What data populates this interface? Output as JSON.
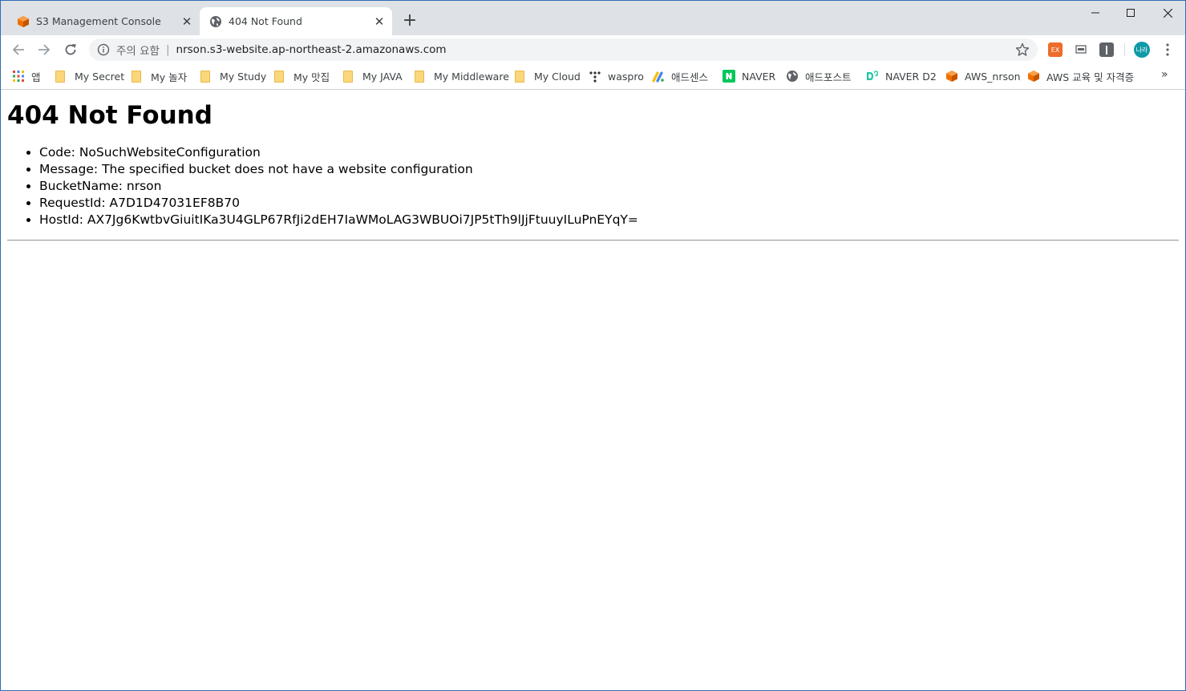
{
  "tabs": [
    {
      "title": "S3 Management Console",
      "icon": "aws-cube-icon",
      "active": false
    },
    {
      "title": "404 Not Found",
      "icon": "globe-icon",
      "active": true
    }
  ],
  "address_bar": {
    "security_label": "주의 요함",
    "url": "nrson.s3-website.ap-northeast-2.amazonaws.com"
  },
  "account": {
    "avatar_text": "나라"
  },
  "bookmarks": [
    {
      "label": "앱",
      "icon": "apps-grid-icon"
    },
    {
      "label": "My Secret",
      "icon": "folder-icon"
    },
    {
      "label": "My 놀자",
      "icon": "folder-icon"
    },
    {
      "label": "My Study",
      "icon": "folder-icon"
    },
    {
      "label": "My 맛집",
      "icon": "folder-icon"
    },
    {
      "label": "My JAVA",
      "icon": "folder-icon"
    },
    {
      "label": "My Middleware",
      "icon": "folder-icon"
    },
    {
      "label": "My Cloud",
      "icon": "folder-icon"
    },
    {
      "label": "waspro",
      "icon": "dots-icon"
    },
    {
      "label": "애드센스",
      "icon": "adsense-icon"
    },
    {
      "label": "NAVER",
      "icon": "naver-icon"
    },
    {
      "label": "애드포스트",
      "icon": "globe-icon"
    },
    {
      "label": "NAVER D2",
      "icon": "d2-icon"
    },
    {
      "label": "AWS_nrson",
      "icon": "aws-cube-icon"
    },
    {
      "label": "AWS 교육 및 자격증",
      "icon": "aws-cube-icon"
    }
  ],
  "page": {
    "heading": "404 Not Found",
    "details": [
      "Code: NoSuchWebsiteConfiguration",
      "Message: The specified bucket does not have a website configuration",
      "BucketName: nrson",
      "RequestId: A7D1D47031EF8B70",
      "HostId: AX7Jg6KwtbvGiuitIKa3U4GLP67RfJi2dEH7IaWMoLAG3WBUOi7JP5tTh9lJjFtuuyILuPnEYqY="
    ]
  },
  "colors": {
    "aws_orange": "#ed7100",
    "naver_green": "#03c75a",
    "d2_teal": "#1ec8a5",
    "avatar": "#0e9aa7"
  }
}
